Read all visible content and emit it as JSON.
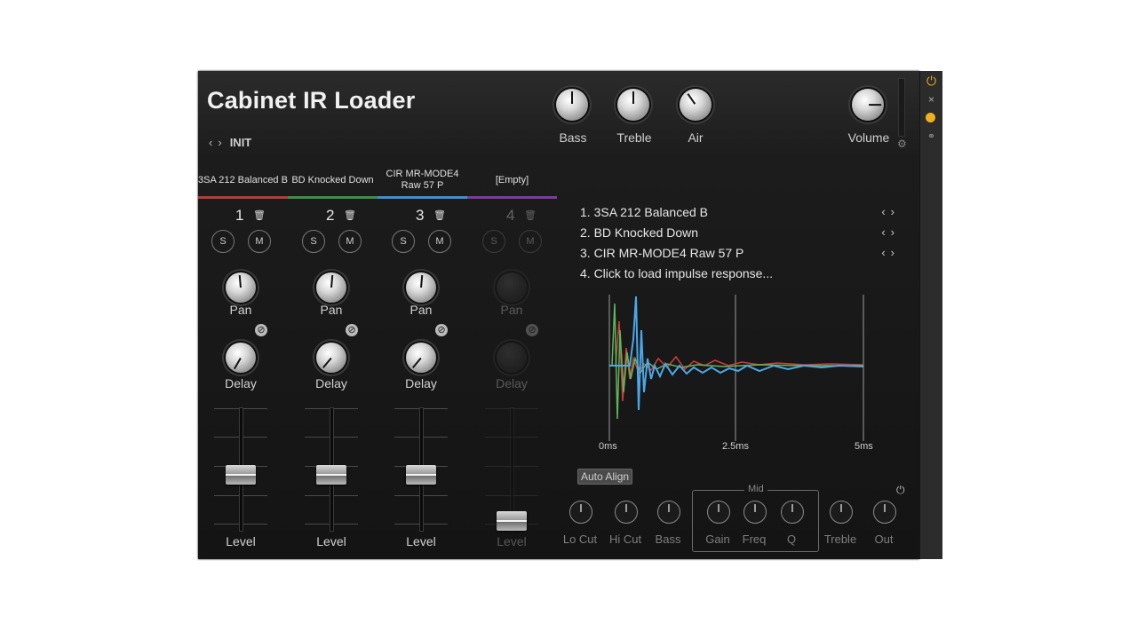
{
  "app": {
    "title": "Cabinet IR Loader",
    "preset_name": "INIT"
  },
  "header_knobs": [
    {
      "label": "Bass"
    },
    {
      "label": "Treble"
    },
    {
      "label": "Air"
    },
    {
      "label": "Volume"
    }
  ],
  "tabs": [
    {
      "label": "3SA 212 Balanced B",
      "color": "#c23a3a"
    },
    {
      "label": "BD Knocked Down",
      "color": "#3aa04a"
    },
    {
      "label": "CIR MR-MODE4 Raw 57 P",
      "color": "#3a8fd6"
    },
    {
      "label": "[Empty]",
      "color": "#8a3ab0"
    }
  ],
  "channels": [
    {
      "number": "1",
      "solo": "S",
      "mute": "M",
      "pan_label": "Pan",
      "delay_label": "Delay",
      "level_label": "Level",
      "level": 0.45
    },
    {
      "number": "2",
      "solo": "S",
      "mute": "M",
      "pan_label": "Pan",
      "delay_label": "Delay",
      "level_label": "Level",
      "level": 0.45
    },
    {
      "number": "3",
      "solo": "S",
      "mute": "M",
      "pan_label": "Pan",
      "delay_label": "Delay",
      "level_label": "Level",
      "level": 0.45
    },
    {
      "number": "4",
      "solo": "S",
      "mute": "M",
      "pan_label": "Pan",
      "delay_label": "Delay",
      "level_label": "Level",
      "level": 0.0
    }
  ],
  "ir_list": [
    {
      "text": "1. 3SA 212 Balanced B"
    },
    {
      "text": "2. BD Knocked Down"
    },
    {
      "text": "3. CIR MR-MODE4 Raw 57 P"
    },
    {
      "text": "4. Click to load impulse response..."
    }
  ],
  "graph": {
    "ticks": [
      "0ms",
      "2.5ms",
      "5ms"
    ]
  },
  "auto_align": "Auto Align",
  "eq": {
    "mid_title": "Mid",
    "knobs": [
      {
        "label": "Lo Cut"
      },
      {
        "label": "Hi Cut"
      },
      {
        "label": "Bass"
      },
      {
        "label": "Gain"
      },
      {
        "label": "Freq"
      },
      {
        "label": "Q"
      },
      {
        "label": "Treble"
      },
      {
        "label": "Out"
      }
    ]
  },
  "colors": {
    "accent": "#f0b020",
    "ir1": "#d23b3b",
    "ir2": "#5cb85c",
    "ir3": "#4aa8e8"
  }
}
